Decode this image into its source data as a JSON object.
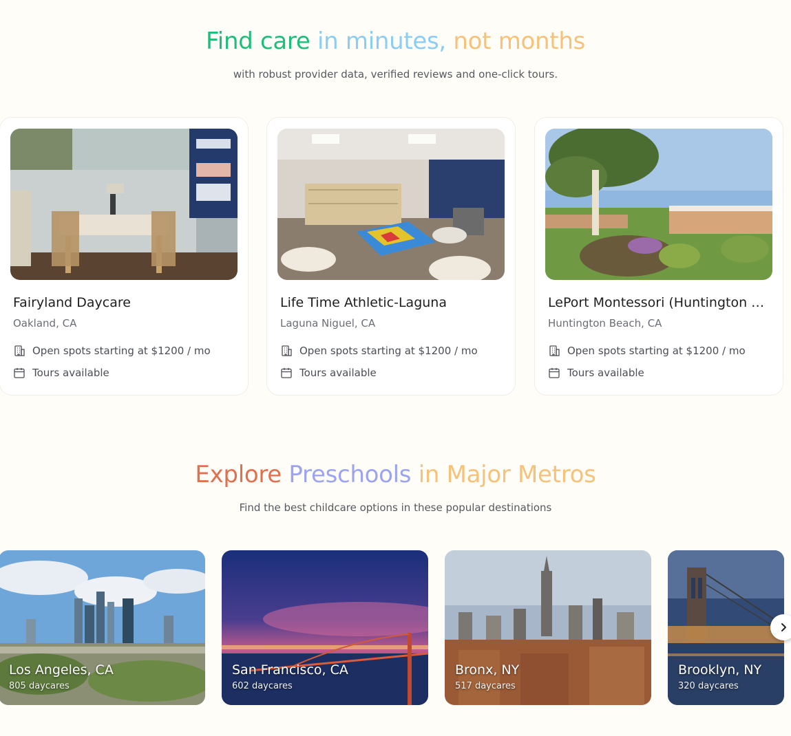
{
  "hero": {
    "title_parts": [
      "Find care",
      " in minutes,",
      " not months"
    ],
    "title_colors": [
      "#1dbd7a",
      "#8ccdf3",
      "#f6c27a"
    ],
    "subtitle": "with robust provider data, verified reviews and one-click tours."
  },
  "providers": [
    {
      "name": "Fairyland Daycare",
      "location": "Oakland, CA",
      "spots": "Open spots starting at $1200 / mo",
      "tours": "Tours available"
    },
    {
      "name": "Life Time Athletic-Laguna",
      "location": "Laguna Niguel, CA",
      "spots": "Open spots starting at $1200 / mo",
      "tours": "Tours available"
    },
    {
      "name": "LePort Montessori (Huntington …",
      "location": "Huntington Beach, CA",
      "spots": "Open spots starting at $1200 / mo",
      "tours": "Tours available"
    }
  ],
  "metros_section": {
    "title_parts": [
      "Explore",
      " Preschools",
      " in Major Metros"
    ],
    "title_colors": [
      "#e07050",
      "#9ca3f0",
      "#f6c27a"
    ],
    "subtitle": "Find the best childcare options in these popular destinations"
  },
  "metros": [
    {
      "name": "Los Angeles, CA",
      "count": "805 daycares"
    },
    {
      "name": "San Francisco, CA",
      "count": "602 daycares"
    },
    {
      "name": "Bronx, NY",
      "count": "517 daycares"
    },
    {
      "name": "Brooklyn, NY",
      "count": "320 daycares"
    }
  ],
  "icons": {
    "spots": "building-icon",
    "tours": "calendar-icon",
    "next": "chevron-right-icon"
  }
}
